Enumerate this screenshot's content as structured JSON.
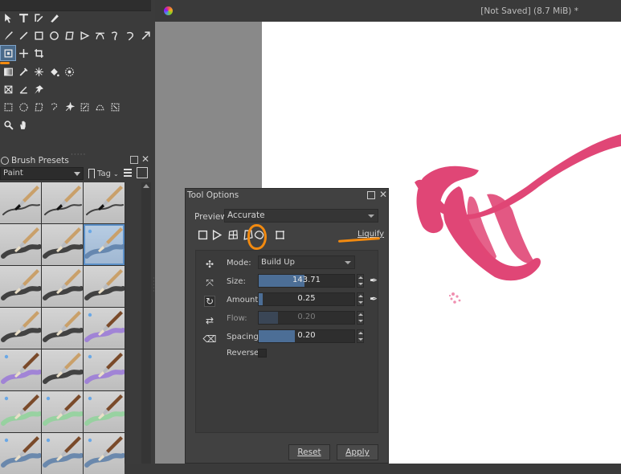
{
  "window": {
    "title": "[Not Saved]  (8.7 MiB) *"
  },
  "toolbox": {
    "rows": [
      [
        "select-shapes-icon",
        "text-icon",
        "edit-shapes-icon",
        "calligraphy-icon"
      ],
      [
        "freehand-brush-icon",
        "line-icon",
        "rectangle-icon",
        "ellipse-icon",
        "polygon-icon",
        "polyline-icon",
        "bezier-icon",
        "freehand-path-icon",
        "dynamic-brush-icon",
        "multibrush-icon"
      ],
      [
        "transform-icon",
        "move-icon",
        "crop-icon"
      ],
      [
        "gradient-icon",
        "color-picker-icon",
        "smart-patch-icon",
        "fill-icon",
        "enclose-fill-icon"
      ],
      [
        "assistant-icon",
        "measure-icon",
        "reference-icon"
      ],
      [
        "rect-select-icon",
        "ellipse-select-icon",
        "polygon-select-icon",
        "freehand-select-icon",
        "contiguous-select-icon",
        "similar-select-icon",
        "bezier-select-icon",
        "magnetic-select-icon"
      ],
      [
        "zoom-icon",
        "pan-icon"
      ]
    ]
  },
  "brush_presets": {
    "title": "Brush Presets",
    "filter_value": "Paint",
    "tag_label": "Tag",
    "presets": [
      "ink-pen",
      "ink-pen-fine",
      "ink-brush",
      "bristle-round",
      "bristle-dark",
      "bristle-blue",
      "bristle-flat",
      "bristle-texture",
      "bristle-fan",
      "bristle-splatter",
      "bristle-chalk",
      "wet-purple",
      "wet-purple-2",
      "palette-knife",
      "wet-purple-3",
      "wet-green",
      "wet-green-2",
      "wet-green-3",
      "wet-blue",
      "wet-blue-2",
      "wet-blue-3"
    ]
  },
  "tool_options": {
    "title": "Tool Options",
    "preview_label": "Preview",
    "preview_value": "Accurate",
    "liquify_link": "Liquify",
    "mode_label": "Mode:",
    "mode_value": "Build Up",
    "size_label": "Size:",
    "size_value": "143.71",
    "size_fill": 0.48,
    "amount_label": "Amount:",
    "amount_value": "0.25",
    "amount_fill": 0.04,
    "flow_label": "Flow:",
    "flow_value": "0.20",
    "flow_fill": 0.2,
    "spacing_label": "Spacing:",
    "spacing_value": "0.20",
    "spacing_fill": 0.38,
    "reverse_label": "Reverse:",
    "reset_label": "Reset",
    "apply_label": "Apply"
  },
  "colors": {
    "accent": "#f28a10",
    "stroke": "#e04676",
    "selection": "#4c6e96"
  }
}
